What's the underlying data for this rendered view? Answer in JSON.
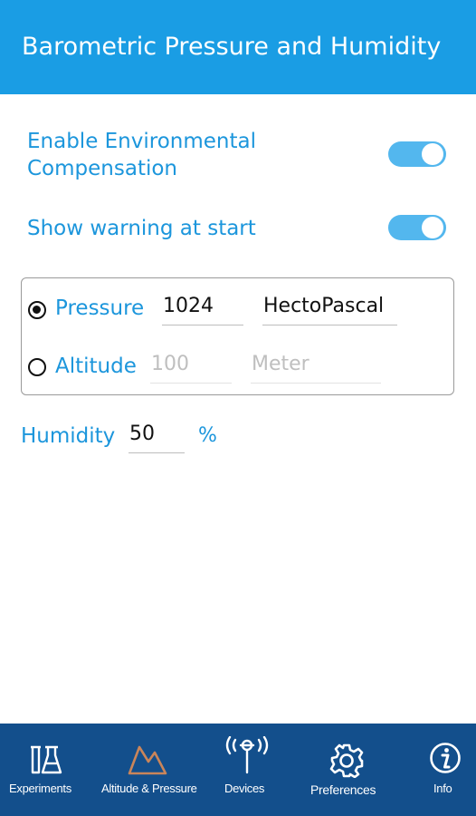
{
  "appbar": {
    "title": "Barometric Pressure and Humidity"
  },
  "settings": {
    "env_comp_label": "Enable Environmental Compensation",
    "env_comp_on": true,
    "warning_label": "Show warning at start",
    "warning_on": true
  },
  "reference": {
    "pressure": {
      "label": "Pressure",
      "value": "1024",
      "unit": "HectoPascal",
      "selected": true
    },
    "altitude": {
      "label": "Altitude",
      "placeholder": "100",
      "unit": "Meter",
      "selected": false
    }
  },
  "humidity": {
    "label": "Humidity",
    "value": "50",
    "unit": "%"
  },
  "nav": [
    {
      "label": "Experiments",
      "icon": "flask-icon",
      "active": false
    },
    {
      "label": "Altitude & Pressure",
      "icon": "mountain-icon",
      "active": true
    },
    {
      "label": "Devices",
      "icon": "sensor-device-icon",
      "active": false
    },
    {
      "label": "Preferences",
      "icon": "gear-icon",
      "active": false
    },
    {
      "label": "Info",
      "icon": "info-icon",
      "active": false
    }
  ],
  "colors": {
    "appbar": "#1a9de4",
    "accent_text": "#1c96dc",
    "navbar": "#134f8c",
    "active_icon": "#c9855a"
  }
}
